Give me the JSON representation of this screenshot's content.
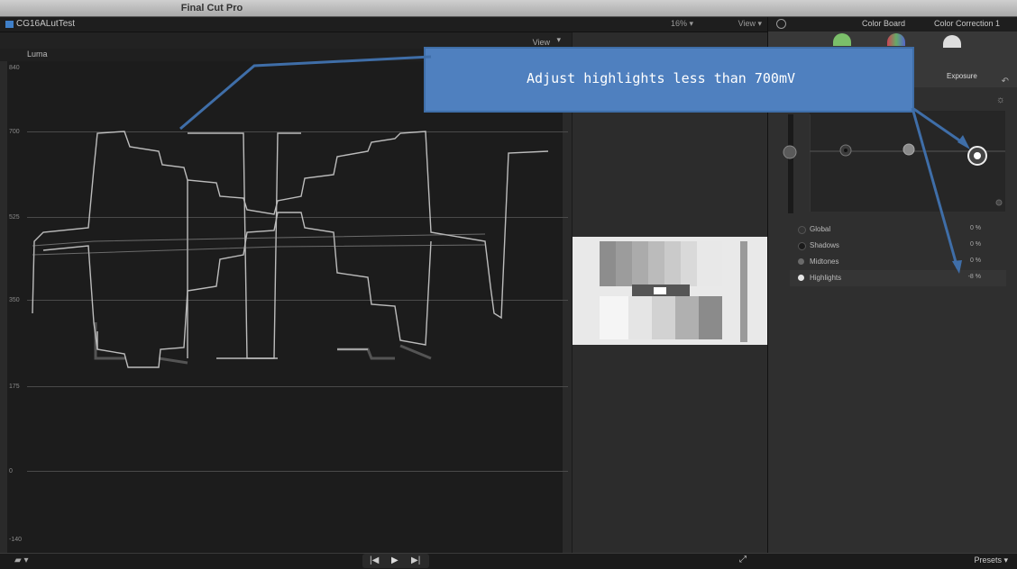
{
  "window": {
    "title": "Final Cut Pro"
  },
  "project": {
    "name": "CG16ALutTest",
    "zoom": "16%",
    "view_label": "View"
  },
  "scope": {
    "view_label": "View",
    "mode_label": "Luma",
    "ticks": [
      "840",
      "700",
      "525",
      "350",
      "175",
      "0",
      "-140"
    ]
  },
  "inspector": {
    "panel_title": "Color Board",
    "correction_title": "Color Correction 1",
    "tab_label": "Exposure",
    "rows": [
      {
        "label": "Global",
        "value": "0 %"
      },
      {
        "label": "Shadows",
        "value": "0 %"
      },
      {
        "label": "Midtones",
        "value": "0 %"
      },
      {
        "label": "Highlights",
        "value": "-8 %"
      }
    ],
    "presets_label": "Presets"
  },
  "annotation": {
    "text": "Adjust highlights less than 700mV",
    "color": "#4f80bf"
  },
  "icons": [
    "project-icon",
    "back-icon",
    "sun-icon",
    "reset-icon",
    "prev-frame-icon",
    "play-icon",
    "next-frame-icon",
    "fullscreen-icon",
    "tool-icon"
  ]
}
